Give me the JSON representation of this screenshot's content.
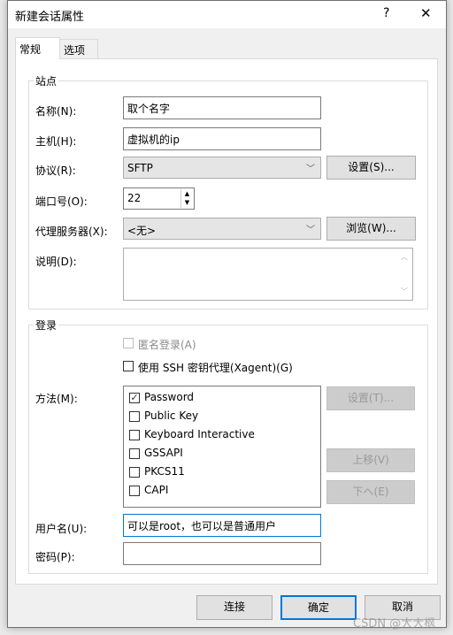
{
  "window": {
    "title": "新建会话属性",
    "help": "?",
    "close": "✕"
  },
  "tabs": [
    {
      "label": "常规"
    },
    {
      "label": "选项"
    }
  ],
  "site": {
    "group_label": "站点",
    "name_label": "名称(N):",
    "name_value": "取个名字",
    "host_label": "主机(H):",
    "host_value": "虚拟机的ip",
    "protocol_label": "协议(R):",
    "protocol_value": "SFTP",
    "protocol_settings": "设置(S)...",
    "port_label": "端口号(O):",
    "port_value": "22",
    "proxy_label": "代理服务器(X):",
    "proxy_value": "<无>",
    "proxy_browse": "浏览(W)...",
    "desc_label": "说明(D):",
    "desc_value": ""
  },
  "login": {
    "group_label": "登录",
    "anonymous": {
      "label": "匿名登录(A)",
      "checked": false,
      "disabled": true
    },
    "ssh_agent": {
      "label": "使用 SSH 密钥代理(Xagent)(G)",
      "checked": false
    },
    "method_label": "方法(M):",
    "methods": [
      {
        "label": "Password",
        "checked": true
      },
      {
        "label": "Public Key",
        "checked": false
      },
      {
        "label": "Keyboard Interactive",
        "checked": false
      },
      {
        "label": "GSSAPI",
        "checked": false
      },
      {
        "label": "PKCS11",
        "checked": false
      },
      {
        "label": "CAPI",
        "checked": false
      }
    ],
    "method_settings": "设置(T)...",
    "move_up": "上移(V)",
    "move_down": "下へ(E)",
    "username_label": "用户名(U):",
    "username_value": "可以是root，也可以是普通用户",
    "password_label": "密码(P):",
    "password_value": ""
  },
  "footer": {
    "connect": "连接",
    "ok": "确定",
    "cancel": "取消"
  },
  "watermark": "CSDN @大大枫"
}
